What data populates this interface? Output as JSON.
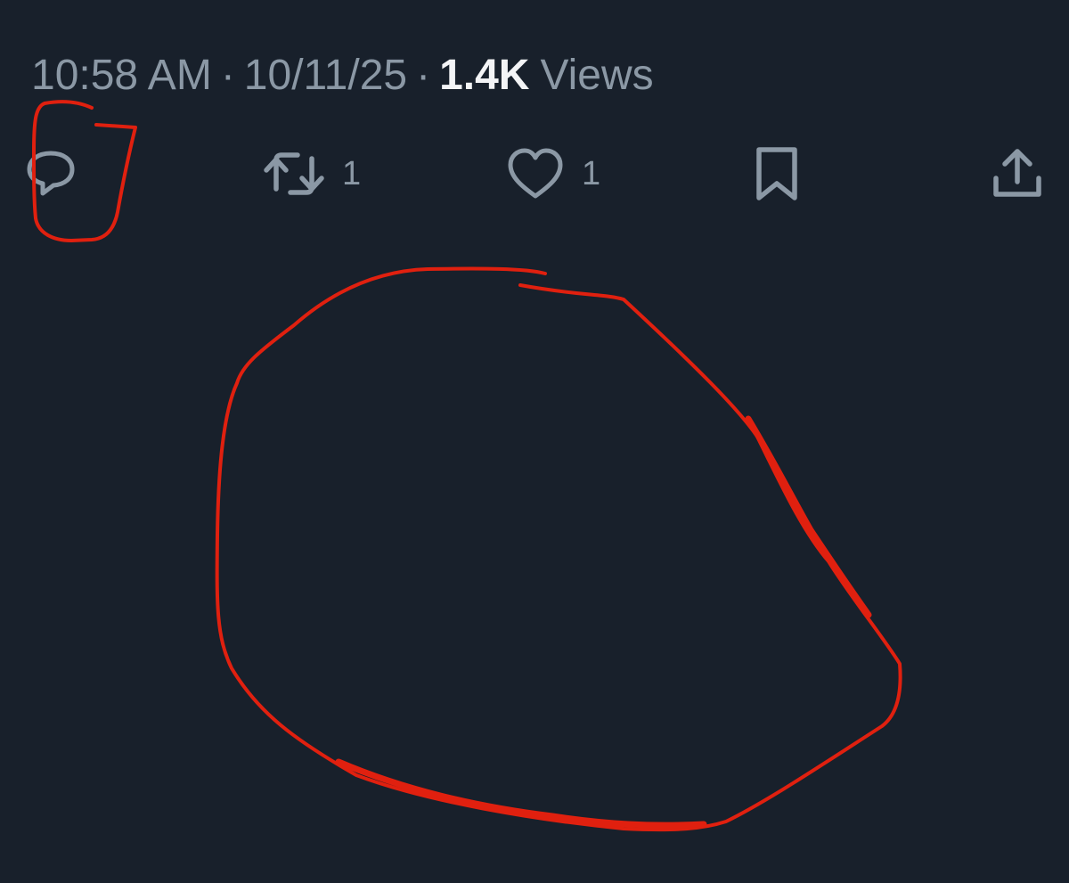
{
  "tweet_meta": {
    "time": "10:58 AM",
    "separator_1": "·",
    "date": "10/11/25",
    "separator_2": "·",
    "views_count": "1.4K",
    "views_label": "Views"
  },
  "actions": {
    "reply": {
      "icon": "reply-icon",
      "count": ""
    },
    "repost": {
      "icon": "repost-icon",
      "count": "1"
    },
    "like": {
      "icon": "heart-icon",
      "count": "1"
    },
    "bookmark": {
      "icon": "bookmark-icon",
      "count": ""
    },
    "share": {
      "icon": "share-icon",
      "count": ""
    }
  },
  "colors": {
    "background": "#18202b",
    "muted_text": "#8b98a5",
    "emphasis_text": "#f3f4f6",
    "annotation": "#e0200f"
  }
}
